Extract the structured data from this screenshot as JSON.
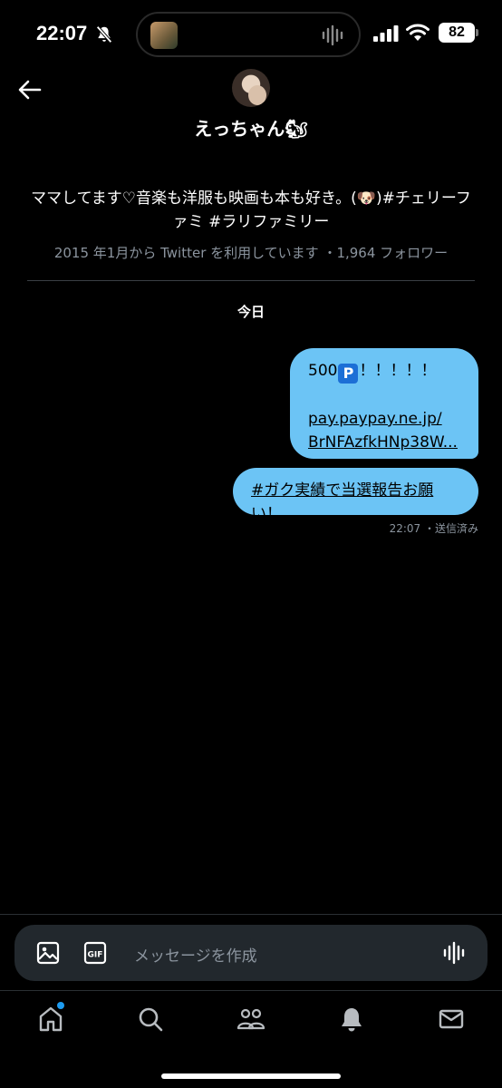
{
  "status_bar": {
    "time": "22:07",
    "battery": "82"
  },
  "header": {
    "display_name": "えっちゃん🐿"
  },
  "profile": {
    "bio_line1": "ママしてます♡音楽も洋服も映画も本も好き。(🐶)#チェリーフ",
    "bio_line2": "ァミ #ラリファミリー",
    "meta": "2015 年1月から Twitter を利用しています ・1,964 フォロワー"
  },
  "conversation": {
    "day_label": "今日",
    "messages": [
      {
        "amount": "500",
        "badge": "P",
        "exclaim": "！！！！！",
        "link_line1": "pay.paypay.ne.jp/",
        "link_line2": "BrNFAzfkHNp38W..."
      },
      {
        "hashtag": "#ガク実績で当選報告お願い",
        "suffix": "！"
      }
    ],
    "sent_meta": "22:07 ・送信済み"
  },
  "composer": {
    "placeholder": "メッセージを作成"
  },
  "tabs": [
    "home-icon",
    "search-icon",
    "communities-icon",
    "notifications-icon",
    "messages-icon"
  ],
  "colors": {
    "bubble": "#6cc4f5",
    "accent": "#1d9bf0",
    "background": "#000000"
  }
}
